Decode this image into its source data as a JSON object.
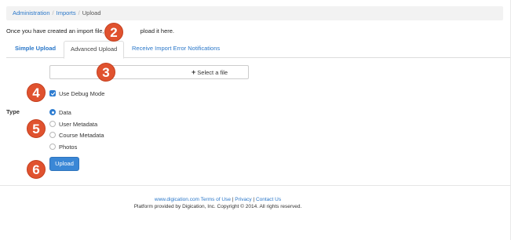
{
  "breadcrumb": {
    "items": [
      "Administration",
      "Imports"
    ],
    "current": "Upload"
  },
  "intro": {
    "part1": "Once you have created an import file,",
    "part2": "pload it here."
  },
  "tabs": [
    {
      "label": "Simple Upload"
    },
    {
      "label": "Advanced Upload"
    },
    {
      "label": "Receive Import Error Notifications"
    }
  ],
  "file_picker": {
    "button_label": "Select a file",
    "plus_icon": "+"
  },
  "debug": {
    "label": "Use Debug Mode",
    "checked": true
  },
  "type": {
    "label": "Type",
    "options": [
      {
        "label": "Data",
        "selected": true
      },
      {
        "label": "User Metadata",
        "selected": false
      },
      {
        "label": "Course Metadata",
        "selected": false
      },
      {
        "label": "Photos",
        "selected": false
      }
    ]
  },
  "upload_button": {
    "label": "Upload"
  },
  "footer": {
    "link_site": "www.digication.com",
    "link_terms": "Terms of Use",
    "sep": "|",
    "link_privacy": "Privacy",
    "link_contact": "Contact Us",
    "copyright": "Platform provided by Digication, Inc. Copyright © 2014. All rights reserved."
  },
  "markers": [
    "2",
    "3",
    "4",
    "5",
    "6"
  ],
  "colors": {
    "link": "#2a77c9",
    "primary": "#3a87d6",
    "marker": "#e0522f"
  }
}
